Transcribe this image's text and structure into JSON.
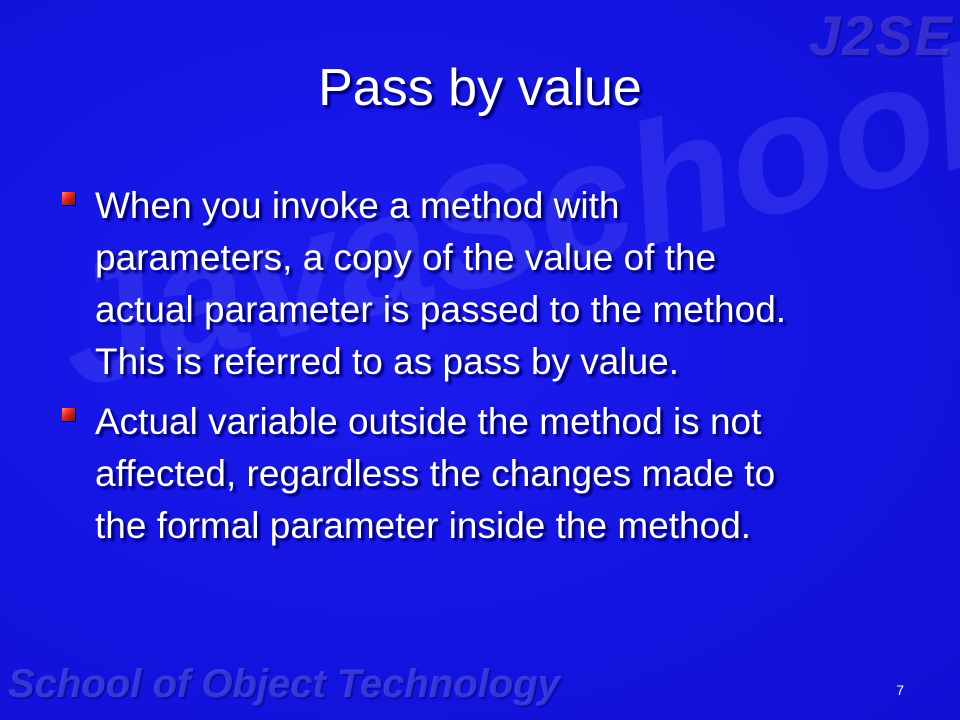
{
  "watermark": {
    "corner": "J2SE",
    "background": "JavaSchool",
    "footer": "School of Object Technology"
  },
  "slide": {
    "title": "Pass by value",
    "bullets": [
      {
        "text": "When you invoke a method with\nparameters, a copy of the value of the\nactual parameter is passed to the method.\nThis is referred to as pass by value."
      },
      {
        "text": "Actual variable outside the method is not\naffected, regardless the changes made to\nthe formal parameter inside the method."
      }
    ],
    "page_number": "7"
  },
  "colors": {
    "background": "#1414e6",
    "text": "#ffffff",
    "bullet_marker": "#e0251a"
  },
  "icons": {
    "bullet": "red-square-bullet-icon"
  }
}
